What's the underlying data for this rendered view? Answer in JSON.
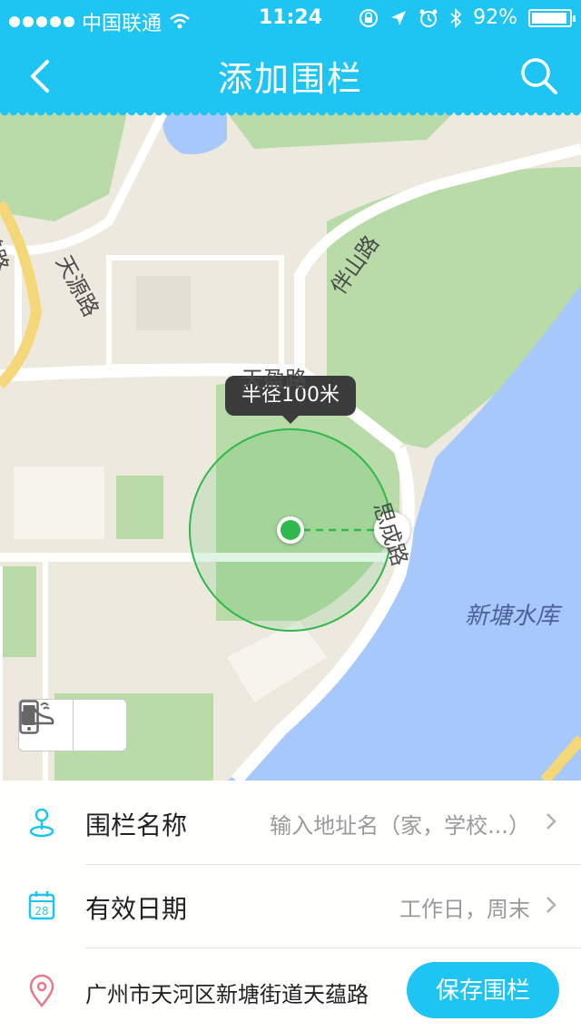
{
  "status": {
    "carrier": "中国联通",
    "time": "11:24",
    "battery": "92%",
    "battery_level": 0.92
  },
  "header": {
    "title": "添加围栏"
  },
  "map": {
    "radius_tooltip": "半径100米",
    "lake_label": "新塘水库",
    "road_labels": [
      "高普路",
      "天源路",
      "伴山路",
      "天盈路",
      "思成路"
    ]
  },
  "form": {
    "name_label": "围栏名称",
    "name_placeholder": "输入地址名（家，学校...）",
    "date_label": "有效日期",
    "date_value": "工作日，周末",
    "address": "广州市天河区新塘街道天蕴路",
    "save_label": "保存围栏",
    "date_icon_day": "28"
  },
  "icons": [
    "signal-icon",
    "wifi-icon",
    "lock-rotation-icon",
    "location-arrow-icon",
    "alarm-icon",
    "bluetooth-icon",
    "battery-icon",
    "back-icon",
    "search-icon",
    "phone-icon",
    "shoe-icon",
    "map-pin-icon",
    "calendar-icon",
    "location-pin-icon",
    "chevron-right-icon"
  ],
  "colors": {
    "accent": "#1fc5f2",
    "fence": "#2fb84b",
    "water": "#a6c8fb",
    "park": "#b8dba8",
    "land": "#eee9df"
  }
}
